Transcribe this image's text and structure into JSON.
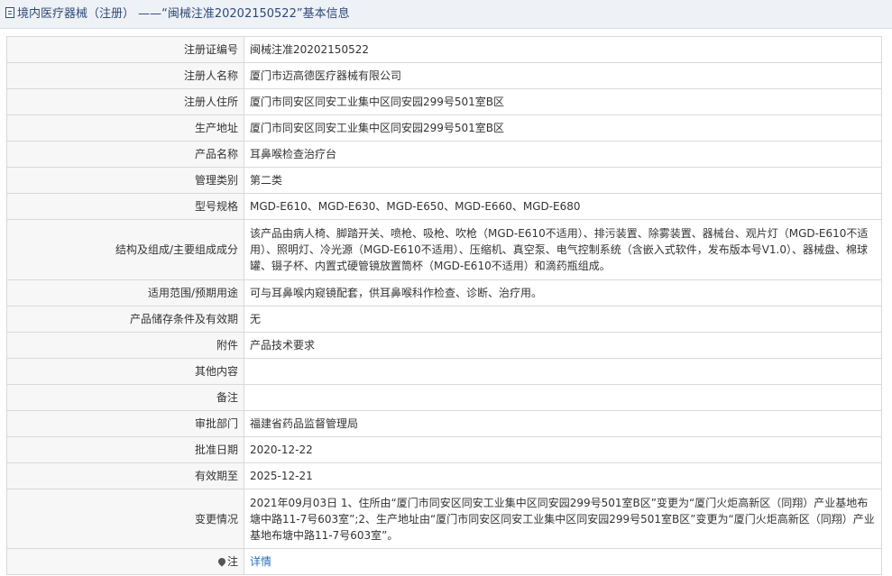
{
  "header": {
    "title": "境内医疗器械（注册） ——“闽械注准20202150522”基本信息"
  },
  "rows": [
    {
      "label": "注册证编号",
      "value": "闽械注准20202150522"
    },
    {
      "label": "注册人名称",
      "value": "厦门市迈高德医疗器械有限公司"
    },
    {
      "label": "注册人住所",
      "value": "厦门市同安区同安工业集中区同安园299号501室B区"
    },
    {
      "label": "生产地址",
      "value": "厦门市同安区同安工业集中区同安园299号501室B区"
    },
    {
      "label": "产品名称",
      "value": "耳鼻喉检查治疗台"
    },
    {
      "label": "管理类别",
      "value": "第二类"
    },
    {
      "label": "型号规格",
      "value": "MGD-E610、MGD-E630、MGD-E650、MGD-E660、MGD-E680"
    },
    {
      "label": "结构及组成/主要组成成分",
      "value": "该产品由病人椅、脚踏开关、喷枪、吸枪、吹枪（MGD-E610不适用）、排污装置、除雾装置、器械台、观片灯（MGD-E610不适用）、照明灯、冷光源（MGD-E610不适用）、压缩机、真空泵、电气控制系统（含嵌入式软件，发布版本号V1.0）、器械盘、棉球罐、镊子杯、内置式硬管镜放置筒杯（MGD-E610不适用）和滴药瓶组成。"
    },
    {
      "label": "适用范围/预期用途",
      "value": "可与耳鼻喉内窥镜配套，供耳鼻喉科作检查、诊断、治疗用。"
    },
    {
      "label": "产品储存条件及有效期",
      "value": "无"
    },
    {
      "label": "附件",
      "value": "产品技术要求"
    },
    {
      "label": "其他内容",
      "value": ""
    },
    {
      "label": "备注",
      "value": ""
    },
    {
      "label": "审批部门",
      "value": "福建省药品监督管理局"
    },
    {
      "label": "批准日期",
      "value": "2020-12-22"
    },
    {
      "label": "有效期至",
      "value": "2025-12-21"
    },
    {
      "label": "变更情况",
      "value": "2021年09月03日 1、住所由“厦门市同安区同安工业集中区同安园299号501室B区”变更为“厦门火炬高新区（同翔）产业基地布塘中路11-7号603室”;2、生产地址由“厦门市同安区同安工业集中区同安园299号501室B区”变更为“厦门火炬高新区（同翔）产业基地布塘中路11-7号603室”。"
    }
  ],
  "note": {
    "label": "注",
    "icon": "pin-icon",
    "link_text": "详情"
  }
}
